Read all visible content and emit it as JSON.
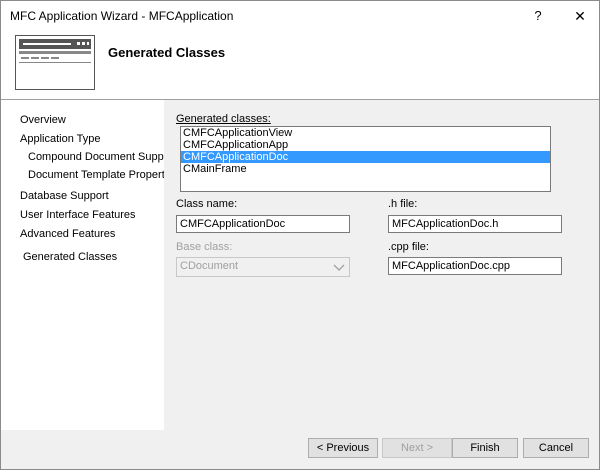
{
  "window": {
    "title": "MFC Application Wizard - MFCApplication"
  },
  "header": {
    "title": "Generated Classes"
  },
  "nav": {
    "items": [
      "Overview",
      "Application Type",
      "Compound Document Support",
      "Document Template Properties",
      "Database Support",
      "User Interface Features",
      "Advanced Features",
      "Generated Classes"
    ]
  },
  "form": {
    "generated_classes_label": "Generated classes:",
    "classes": [
      "CMFCApplicationView",
      "CMFCApplicationApp",
      "CMFCApplicationDoc",
      "CMainFrame"
    ],
    "selected_class": "CMFCApplicationDoc",
    "class_name_label": "Class name:",
    "class_name_value": "CMFCApplicationDoc",
    "h_file_label": ".h file:",
    "h_file_value": "MFCApplicationDoc.h",
    "base_class_label": "Base class:",
    "base_class_value": "CDocument",
    "cpp_file_label": ".cpp file:",
    "cpp_file_value": "MFCApplicationDoc.cpp"
  },
  "buttons": {
    "previous": "< Previous",
    "next": "Next >",
    "finish": "Finish",
    "cancel": "Cancel"
  }
}
